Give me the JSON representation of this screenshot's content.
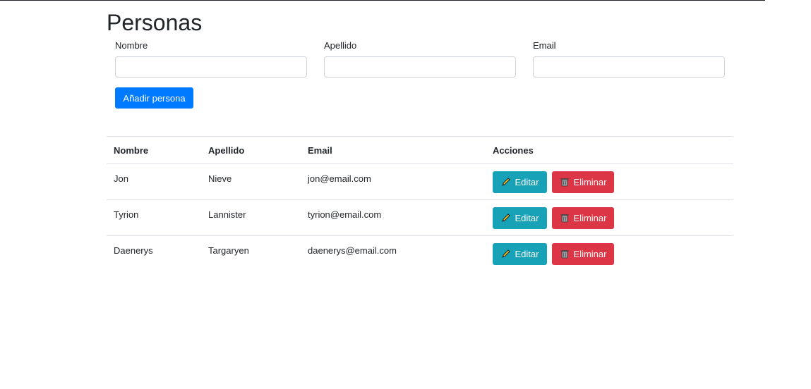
{
  "page": {
    "title": "Personas"
  },
  "form": {
    "nombre_label": "Nombre",
    "nombre_value": "",
    "apellido_label": "Apellido",
    "apellido_value": "",
    "email_label": "Email",
    "email_value": "",
    "submit_label": "Añadir persona"
  },
  "table": {
    "headers": [
      "Nombre",
      "Apellido",
      "Email",
      "Acciones"
    ],
    "rows": [
      {
        "nombre": "Jon",
        "apellido": "Nieve",
        "email": "jon@email.com",
        "edit_label": "Editar",
        "delete_label": "Eliminar"
      },
      {
        "nombre": "Tyrion",
        "apellido": "Lannister",
        "email": "tyrion@email.com",
        "edit_label": "Editar",
        "delete_label": "Eliminar"
      },
      {
        "nombre": "Daenerys",
        "apellido": "Targaryen",
        "email": "daenerys@email.com",
        "edit_label": "Editar",
        "delete_label": "Eliminar"
      }
    ]
  },
  "icons": {
    "edit": "pencil-icon",
    "delete": "trash-icon"
  },
  "colors": {
    "primary": "#007bff",
    "info": "#17a2b8",
    "danger": "#dc3545"
  }
}
